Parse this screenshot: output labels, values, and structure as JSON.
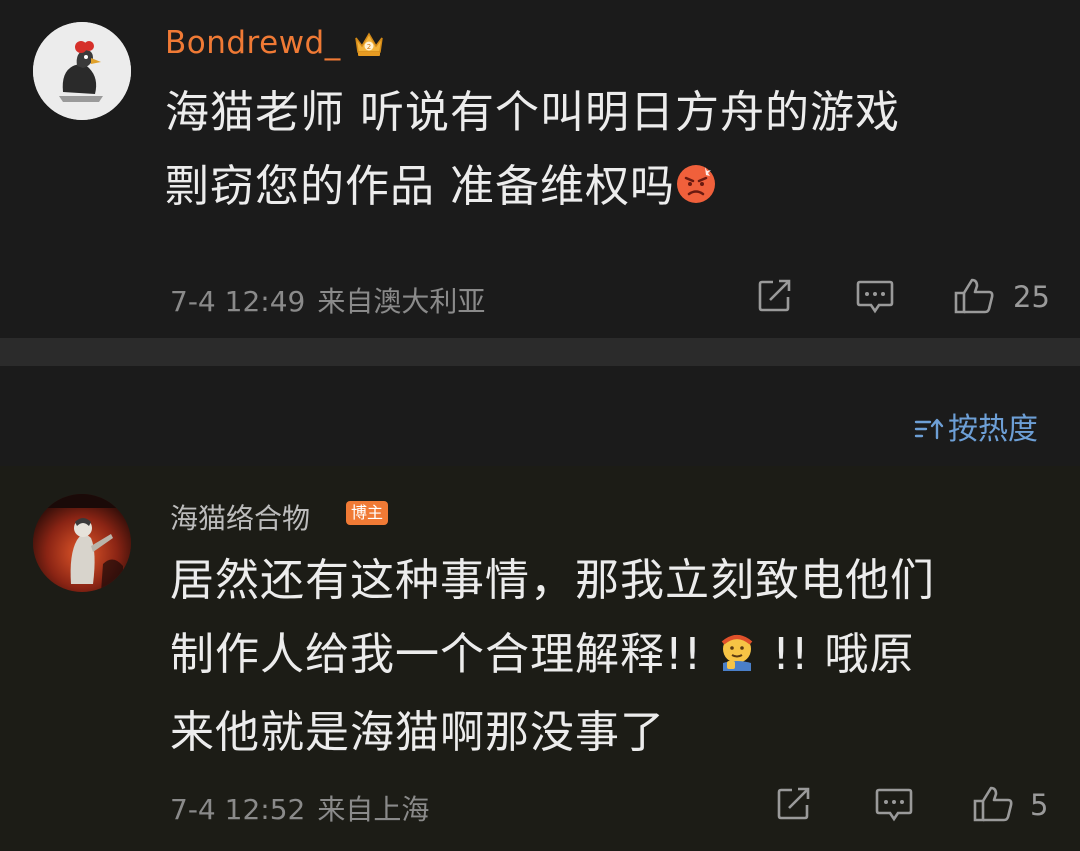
{
  "comments": [
    {
      "username": "Bondrewd_",
      "badge_icon": "crown-icon",
      "text_line1": "海猫老师 听说有个叫明日方舟的游戏",
      "text_line2": "剽窃您的作品 准备维权吗",
      "inline_emoji": "angry-face-emoji",
      "time": "7-4 12:49",
      "location": "来自澳大利亚",
      "likes": "25"
    },
    {
      "username": "海猫络合物",
      "tag": "博主",
      "text_line1": "居然还有这种事情，那我立刻致电他们",
      "text_line2a": "制作人给我一个合理解释!!",
      "inline_emoji": "thinking-face-emoji",
      "text_line2b": "!! 哦原",
      "text_line3": "来他就是海猫啊那没事了",
      "time": "7-4 12:52",
      "location": "来自上海",
      "likes": "5"
    }
  ],
  "sort": {
    "label": "按热度",
    "icon": "sort-icon"
  },
  "colors": {
    "accent": "#f07a35",
    "link": "#6d9fd6",
    "background": "#1b1b1b"
  }
}
